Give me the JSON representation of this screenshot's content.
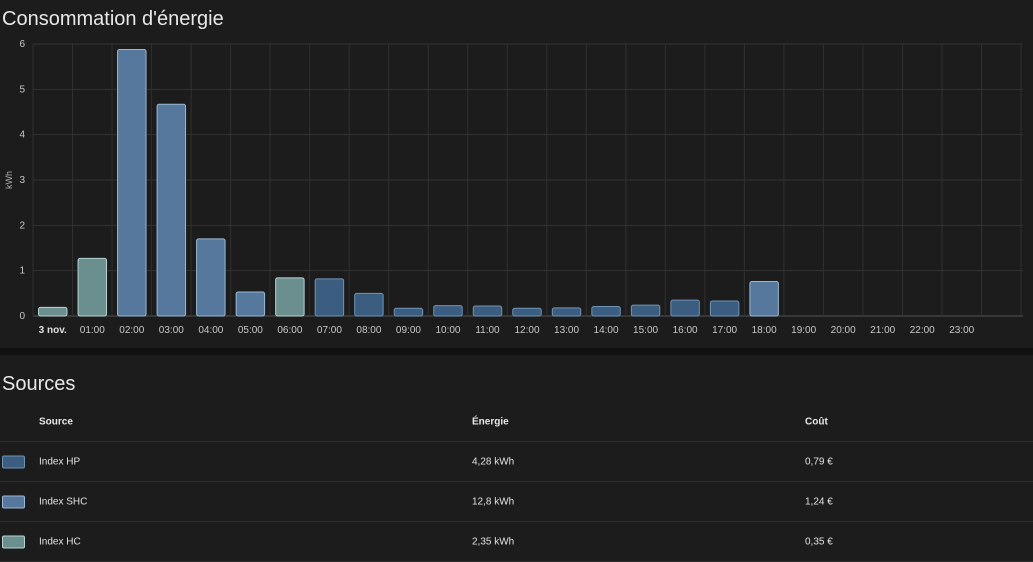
{
  "energy_card": {
    "title": "Consommation d'énergie"
  },
  "sources_card": {
    "title": "Sources",
    "columns": {
      "source": "Source",
      "energy": "Énergie",
      "cost": "Coût"
    },
    "rows": [
      {
        "name": "Index HP",
        "energy": "4,28 kWh",
        "cost": "0,79 €",
        "color": "#3b5d7f",
        "border": "#6f93b6"
      },
      {
        "name": "Index SHC",
        "energy": "12,8 kWh",
        "cost": "1,24 €",
        "color": "#55789c",
        "border": "#9bb9d6"
      },
      {
        "name": "Index HC",
        "energy": "2,35 kWh",
        "cost": "0,35 €",
        "color": "#6b8f8f",
        "border": "#b7d3d3"
      }
    ]
  },
  "chart_data": {
    "type": "bar",
    "ylabel": "kWh",
    "ylim": [
      0,
      6
    ],
    "yticks": [
      "0",
      "1",
      "2",
      "3",
      "4",
      "5",
      "6"
    ],
    "categories": [
      "3 nov.",
      "01:00",
      "02:00",
      "03:00",
      "04:00",
      "05:00",
      "06:00",
      "07:00",
      "08:00",
      "09:00",
      "10:00",
      "11:00",
      "12:00",
      "13:00",
      "14:00",
      "15:00",
      "16:00",
      "17:00",
      "18:00",
      "19:00",
      "20:00",
      "21:00",
      "22:00",
      "23:00"
    ],
    "series": [
      {
        "name": "Index HP",
        "color": "#3b5d7f",
        "values": [
          0,
          0,
          0,
          0,
          0,
          0,
          0,
          0.82,
          0.5,
          0.17,
          0.23,
          0.22,
          0.17,
          0.18,
          0.21,
          0.24,
          0.35,
          0.33,
          0,
          0,
          0,
          0,
          0,
          0
        ]
      },
      {
        "name": "Index SHC",
        "color": "#55789c",
        "values": [
          0,
          0,
          5.88,
          4.67,
          1.7,
          0.53,
          0,
          0,
          0,
          0,
          0,
          0,
          0,
          0,
          0,
          0,
          0,
          0,
          0.76,
          0,
          0,
          0,
          0,
          0
        ]
      },
      {
        "name": "Index HC",
        "color": "#6b8f8f",
        "values": [
          0.19,
          1.27,
          0,
          0,
          0,
          0,
          0.84,
          0,
          0,
          0,
          0,
          0,
          0,
          0,
          0,
          0,
          0,
          0,
          0,
          0,
          0,
          0,
          0,
          0
        ]
      }
    ],
    "grid": true,
    "legend": "none"
  }
}
